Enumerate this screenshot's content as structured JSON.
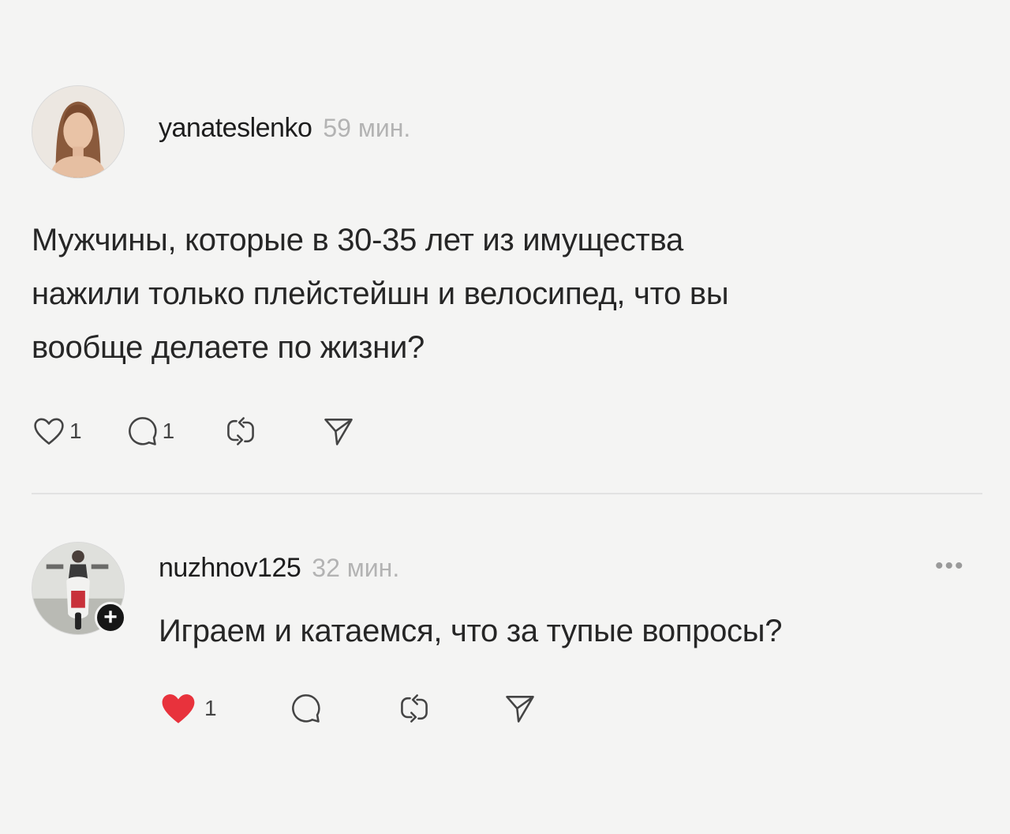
{
  "post": {
    "username": "yanateslenko",
    "time": "59 мин.",
    "text_lines": [
      "Мужчины, которые в 30-35 лет из имущества",
      "нажили только плейстейшн и велосипед, что вы",
      "вообще делаете по жизни?"
    ],
    "likes": "1",
    "replies": "1",
    "icons": [
      "heart-icon",
      "comment-icon",
      "repost-icon",
      "share-icon"
    ]
  },
  "reply": {
    "username": "nuzhnov125",
    "time": "32 мин.",
    "text": "Играем и катаемся, что за тупые вопросы?",
    "likes": "1",
    "more_label": "•••",
    "follow_badge": "+",
    "liked_color": "#e8323c",
    "icons": [
      "heart-filled-icon",
      "comment-icon",
      "repost-icon",
      "share-icon"
    ]
  }
}
